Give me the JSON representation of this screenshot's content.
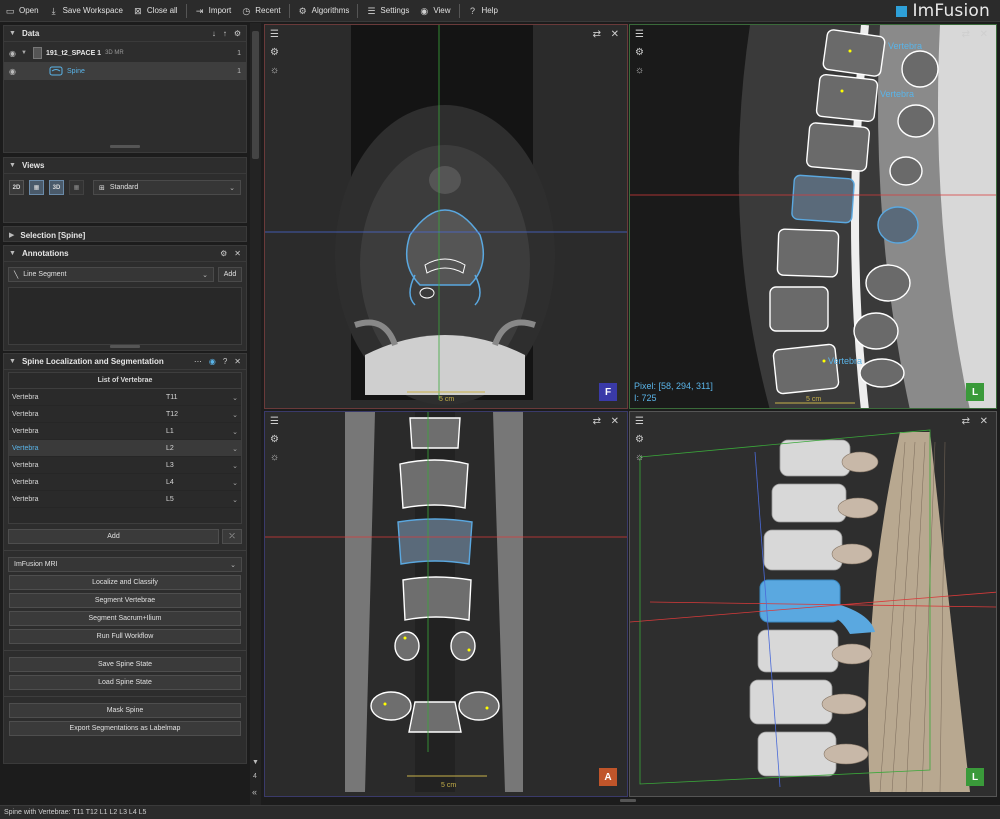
{
  "toolbar": {
    "open": "Open",
    "save_workspace": "Save Workspace",
    "close_all": "Close all",
    "import": "Import",
    "recent": "Recent",
    "algorithms": "Algorithms",
    "settings": "Settings",
    "view": "View",
    "help": "Help"
  },
  "logo": "ImFusion",
  "data_panel": {
    "title": "Data",
    "items": [
      {
        "name": "191_t2_SPACE 1",
        "tag": "3D  MR",
        "count": "1"
      },
      {
        "name": "Spine",
        "count": "1"
      }
    ]
  },
  "views_panel": {
    "title": "Views",
    "buttons": [
      "2D",
      "",
      "3D",
      ""
    ],
    "layout": "Standard"
  },
  "selection_panel": {
    "title": "Selection [Spine]"
  },
  "annotations_panel": {
    "title": "Annotations",
    "type": "Line Segment",
    "add": "Add"
  },
  "spine_panel": {
    "title": "Spine Localization and Segmentation",
    "list_title": "List of Vertebrae",
    "rows": [
      {
        "name": "Vertebra",
        "level": "T11"
      },
      {
        "name": "Vertebra",
        "level": "T12"
      },
      {
        "name": "Vertebra",
        "level": "L1"
      },
      {
        "name": "Vertebra",
        "level": "L2"
      },
      {
        "name": "Vertebra",
        "level": "L3"
      },
      {
        "name": "Vertebra",
        "level": "L4"
      },
      {
        "name": "Vertebra",
        "level": "L5"
      }
    ],
    "add": "Add",
    "model": "ImFusion MRI",
    "actions": [
      "Localize and Classify",
      "Segment Vertebrae",
      "Segment Sacrum+Ilium",
      "Run Full Workflow"
    ],
    "state_actions": [
      "Save Spine State",
      "Load Spine State"
    ],
    "mask_actions": [
      "Mask Spine",
      "Export Segmentations as Labelmap"
    ]
  },
  "scrollbar": {
    "page": "4"
  },
  "views": {
    "top_left": {
      "badge": "F",
      "badge_color": "#3a3aa8",
      "scale": "5 cm"
    },
    "top_right": {
      "badge": "L",
      "badge_color": "#3a9a3a",
      "scale": "5 cm",
      "pixel": "Pixel: [58, 294, 311]",
      "intensity": "I: 725",
      "labels": [
        "Vertebra",
        "Vertebra",
        "Vertebra"
      ]
    },
    "bottom_left": {
      "badge": "A",
      "badge_color": "#c0552a",
      "scale": "5 cm"
    },
    "bottom_right": {
      "badge": "L",
      "badge_color": "#3a9a3a"
    }
  },
  "status": "Spine with Vertebrae: T11 T12 L1 L2 L3 L4 L5"
}
